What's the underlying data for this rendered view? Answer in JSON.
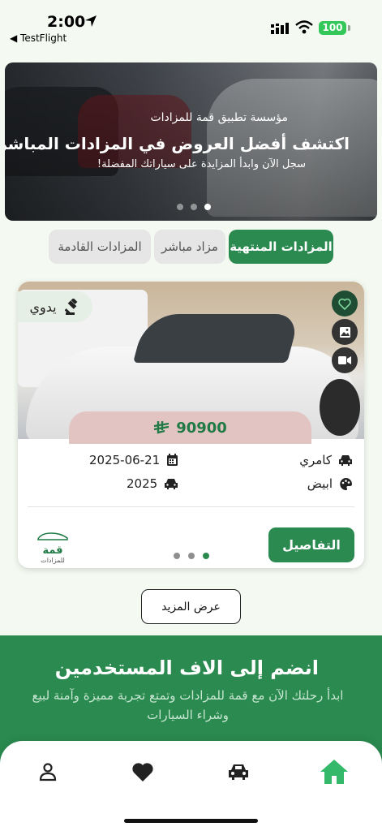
{
  "status_bar": {
    "time": "2:00",
    "back_app": "◀ TestFlight",
    "battery": "100"
  },
  "hero": {
    "subtitle": "مؤسسة تطبيق قمة للمزادات",
    "title": "اكتشف أفضل العروض في المزادات المباشرة",
    "description": "سجل الآن وابدأ المزايدة على سياراتك المفضلة!",
    "slides": 3,
    "active_slide": 3
  },
  "tabs": [
    {
      "label": "المزادات المنتهية",
      "active": true
    },
    {
      "label": "مزاد مباشر",
      "active": false
    },
    {
      "label": "المزادات القادمة",
      "active": false
    }
  ],
  "card": {
    "condition": "يدوي",
    "price": "90900",
    "model": "كامري",
    "date": "2025-06-21",
    "color": "ابيض",
    "year": "2025",
    "details_label": "التفاصيل",
    "logo_top": "قمة",
    "logo_bottom": "للمزادات"
  },
  "more_label": "عرض المزيد",
  "join": {
    "title": "انضم إلى الاف المستخدمين",
    "description": "ابدأ رحلتك الآن مع قمة للمزادات وتمتع تجربة مميزة وآمنة لبيع وشراء السيارات"
  },
  "colors": {
    "brand_green": "#2a8a4f",
    "price_bg": "#e2c4c2"
  }
}
